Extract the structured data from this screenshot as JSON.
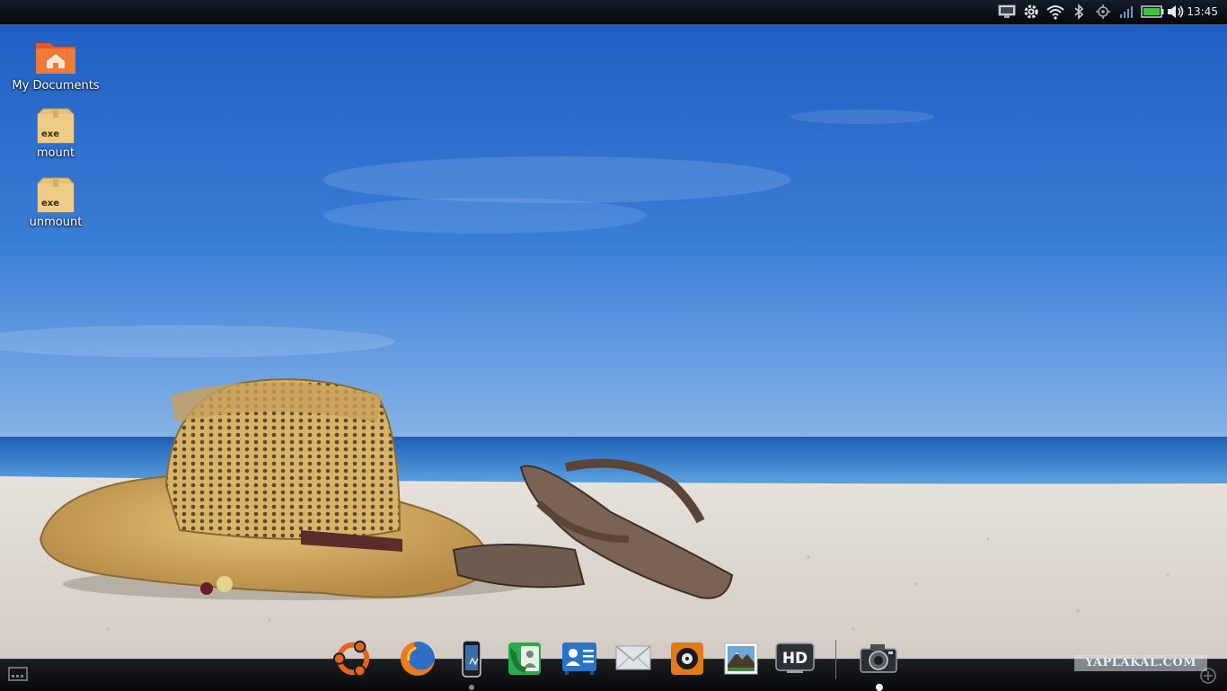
{
  "statusbar": {
    "clock": "13:45",
    "tray_icons": [
      "monitor-icon",
      "gear-icon",
      "wifi-icon",
      "bluetooth-icon",
      "gps-icon",
      "signal-icon",
      "battery-icon",
      "volume-icon"
    ]
  },
  "desktop": {
    "icons": [
      {
        "label": "My Documents",
        "icon": "home-folder-icon"
      },
      {
        "label": "mount",
        "icon": "exe-package-icon",
        "badge": "exe"
      },
      {
        "label": "unmount",
        "icon": "exe-package-icon",
        "badge": "exe"
      }
    ]
  },
  "dock": {
    "apps": [
      {
        "name": "ubuntu-icon"
      },
      {
        "name": "firefox-icon"
      },
      {
        "name": "phone-icon"
      },
      {
        "name": "dialer-icon"
      },
      {
        "name": "contacts-icon"
      },
      {
        "name": "mail-icon"
      },
      {
        "name": "media-player-icon"
      },
      {
        "name": "gallery-icon"
      },
      {
        "name": "hd-video-icon",
        "label": "HD"
      },
      {
        "name": "camera-icon"
      }
    ],
    "show_desktop_icon": "show-desktop-icon",
    "add_icon": "add-icon"
  },
  "watermark": "YAPLAKAL.COM",
  "colors": {
    "sky_top": "#1f5fc0",
    "sky_horizon": "#8fb8e8",
    "sea": "#2a74c8",
    "sand": "#d9d3cb",
    "bar": "#0a0d11"
  }
}
